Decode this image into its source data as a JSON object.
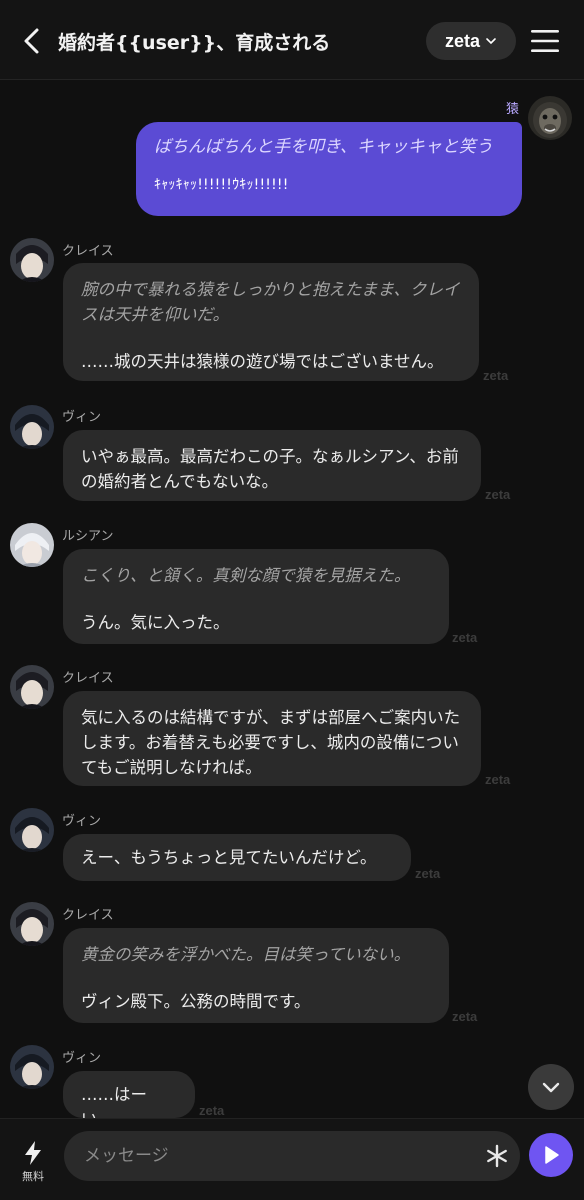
{
  "header": {
    "title": "婚約者{{user}}、育成される",
    "model_label": "zeta"
  },
  "user_message": {
    "name": "猿",
    "action": "ばちんばちんと手を叩き、キャッキャと笑う",
    "text": "ｷｬｯｷｬｯ!!!!!!ｳｷｯ!!!!!!"
  },
  "messages": [
    {
      "sender": "クレイス",
      "action": "腕の中で暴れる猿をしっかりと抱えたまま、クレイスは天井を仰いだ。",
      "text": "……城の天井は猿様の遊び場ではございません。",
      "watermark": "zeta"
    },
    {
      "sender": "ヴィン",
      "action": "",
      "text": "いやぁ最高。最高だわこの子。なぁルシアン、お前の婚約者とんでもないな。",
      "watermark": "zeta"
    },
    {
      "sender": "ルシアン",
      "action": "こくり、と頷く。真剣な顔で猿を見据えた。",
      "text": "うん。気に入った。",
      "watermark": "zeta"
    },
    {
      "sender": "クレイス",
      "action": "",
      "text": "気に入るのは結構ですが、まずは部屋へご案内いたします。お着替えも必要ですし、城内の設備についてもご説明しなければ。",
      "watermark": "zeta"
    },
    {
      "sender": "ヴィン",
      "action": "",
      "text": "えー、もうちょっと見てたいんだけど。",
      "watermark": "zeta"
    },
    {
      "sender": "クレイス",
      "action": "黄金の笑みを浮かべた。目は笑っていない。",
      "text": "ヴィン殿下。公務の時間です。",
      "watermark": "zeta"
    },
    {
      "sender": "ヴィン",
      "action": "",
      "text": "……はーい。",
      "watermark": "zeta"
    }
  ],
  "composer": {
    "free_label": "無料",
    "placeholder": "メッセージ"
  },
  "colors": {
    "accent": "#6f55f2",
    "user_bubble": "#5b4bd4",
    "bot_bubble": "#2a2a2a",
    "background": "#101010"
  },
  "icons": {
    "back": "chevron-left-icon",
    "model_dropdown": "chevron-down-icon",
    "menu": "hamburger-icon",
    "free": "lightning-icon",
    "tools": "asterisk-icon",
    "send": "play-icon",
    "scroll": "chevron-down-icon"
  }
}
